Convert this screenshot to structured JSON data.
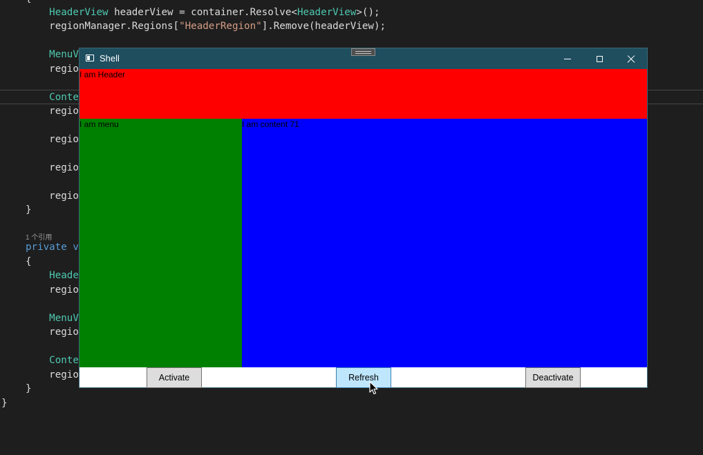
{
  "editor": {
    "lines": [
      {
        "id": "l0",
        "parts": [
          {
            "t": "{",
            "c": "plain"
          }
        ]
      },
      {
        "id": "l1",
        "parts": [
          {
            "t": "    ",
            "c": "plain"
          },
          {
            "t": "HeaderView",
            "c": "type"
          },
          {
            "t": " headerView = container.Resolve<",
            "c": "plain"
          },
          {
            "t": "HeaderView",
            "c": "type"
          },
          {
            "t": ">();",
            "c": "plain"
          }
        ]
      },
      {
        "id": "l2",
        "parts": [
          {
            "t": "    regionManager.Regions[",
            "c": "plain"
          },
          {
            "t": "\"HeaderRegion\"",
            "c": "str"
          },
          {
            "t": "].Remove(headerView);",
            "c": "plain"
          }
        ]
      },
      {
        "id": "l3",
        "parts": [
          {
            "t": "    ",
            "c": "plain"
          },
          {
            "t": "MenuV",
            "c": "type"
          }
        ]
      },
      {
        "id": "l4",
        "parts": [
          {
            "t": "    regio",
            "c": "plain"
          }
        ]
      },
      {
        "id": "l5",
        "parts": [
          {
            "t": "    ",
            "c": "plain"
          },
          {
            "t": "Conte",
            "c": "type"
          }
        ]
      },
      {
        "id": "l6",
        "parts": [
          {
            "t": "    regio",
            "c": "plain"
          }
        ]
      },
      {
        "id": "l7",
        "parts": [
          {
            "t": "    regio",
            "c": "plain"
          }
        ]
      },
      {
        "id": "l8",
        "parts": [
          {
            "t": "    regio",
            "c": "plain"
          }
        ]
      },
      {
        "id": "l9",
        "parts": [
          {
            "t": "    regio",
            "c": "plain"
          }
        ]
      },
      {
        "id": "l10",
        "parts": [
          {
            "t": "}",
            "c": "plain"
          }
        ]
      },
      {
        "id": "l11",
        "parts": [
          {
            "t": "private v",
            "c": "kw"
          }
        ]
      },
      {
        "id": "l12",
        "parts": [
          {
            "t": "{",
            "c": "plain"
          }
        ]
      },
      {
        "id": "l13",
        "parts": [
          {
            "t": "    ",
            "c": "plain"
          },
          {
            "t": "Heade",
            "c": "type"
          }
        ]
      },
      {
        "id": "l14",
        "parts": [
          {
            "t": "    regio",
            "c": "plain"
          }
        ]
      },
      {
        "id": "l15",
        "parts": [
          {
            "t": "    ",
            "c": "plain"
          },
          {
            "t": "MenuV",
            "c": "type"
          }
        ]
      },
      {
        "id": "l16",
        "parts": [
          {
            "t": "    regio",
            "c": "plain"
          }
        ]
      },
      {
        "id": "l17",
        "parts": [
          {
            "t": "    ",
            "c": "plain"
          },
          {
            "t": "Conte",
            "c": "type"
          }
        ]
      },
      {
        "id": "l18",
        "parts": [
          {
            "t": "    regio",
            "c": "plain"
          }
        ]
      },
      {
        "id": "l19",
        "parts": [
          {
            "t": "}",
            "c": "plain"
          }
        ]
      },
      {
        "id": "l20",
        "parts": [
          {
            "t": "}",
            "c": "plain"
          }
        ]
      }
    ],
    "codelens": "1 个引用"
  },
  "window": {
    "title": "Shell",
    "header_text": "I am Header",
    "menu_text": "I am menu",
    "content_text": "I am content 71",
    "colors": {
      "titlebar": "#1f4e5f",
      "header": "#ff0000",
      "menu": "#008000",
      "content": "#0000ff"
    }
  },
  "buttons": {
    "activate": "Activate",
    "refresh": "Refresh",
    "deactivate": "Deactivate"
  }
}
